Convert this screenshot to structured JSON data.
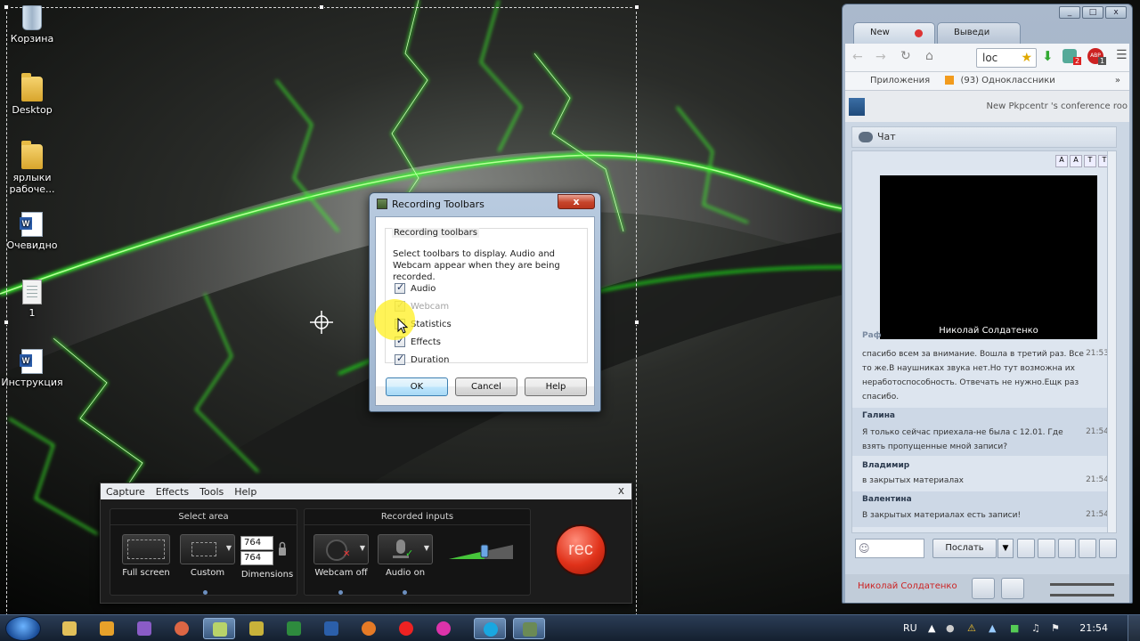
{
  "desktop": {
    "icons": [
      {
        "label": "Корзина",
        "icon": "recycle-bin-icon"
      },
      {
        "label": "Desktop",
        "icon": "folder-icon"
      },
      {
        "label": "ярлыки рабоче...",
        "icon": "folder-icon"
      },
      {
        "label": "Очевидно",
        "icon": "word-document-icon"
      },
      {
        "label": "1",
        "icon": "text-document-icon"
      },
      {
        "label": "Инструкция",
        "icon": "word-document-icon"
      }
    ]
  },
  "dialog": {
    "title": "Recording Toolbars",
    "close_label": "x",
    "group_label": "Recording toolbars",
    "description": "Select toolbars to display. Audio and Webcam appear when they are being recorded.",
    "options": [
      {
        "label": "Audio",
        "checked": true,
        "enabled": true
      },
      {
        "label": "Webcam",
        "checked": true,
        "enabled": false
      },
      {
        "label": "Statistics",
        "checked": false,
        "enabled": true
      },
      {
        "label": "Effects",
        "checked": true,
        "enabled": true
      },
      {
        "label": "Duration",
        "checked": true,
        "enabled": true
      }
    ],
    "ok_label": "OK",
    "cancel_label": "Cancel",
    "help_label": "Help"
  },
  "recorder": {
    "menu": [
      "Capture",
      "Effects",
      "Tools",
      "Help"
    ],
    "close_label": "x",
    "select_area": {
      "title": "Select area",
      "full_screen_label": "Full screen",
      "custom_label": "Custom",
      "dimensions_label": "Dimensions",
      "width": "764",
      "height": "764"
    },
    "recorded_inputs": {
      "title": "Recorded inputs",
      "webcam_label": "Webcam off",
      "audio_label": "Audio on",
      "audio_level": 0.55
    },
    "rec_label": "rec"
  },
  "browser": {
    "window_buttons": [
      "_",
      "□",
      "x"
    ],
    "tabs": [
      "New",
      "Выведи"
    ],
    "url_text": "loc",
    "abp_badge": "ABP",
    "ext_badges": [
      "2",
      "1"
    ],
    "bookmarks": [
      "Приложения",
      "(93) Одноклассники"
    ],
    "conference_title": "New Pkpcentr 's conference roo",
    "chat": {
      "header": "Чат",
      "video_name": "Николай Солдатенко",
      "partial_name": "Раф",
      "messages": [
        {
          "name": "",
          "text": "спасибо всем за внимание. Вошла в третий раз. Все то же.В наушниках звука нет.Но тут возможна их неработоспособность. Отвечать не нужно.Ещк раз спасибо.",
          "time": "21:53"
        },
        {
          "name": "Галина",
          "text": "Я только сейчас приехала-не была с 12.01. Где взять пропущенные мной записи?",
          "time": "21:54"
        },
        {
          "name": "Владимир",
          "text": "в закрытых материалах",
          "time": "21:54"
        },
        {
          "name": "Валентина",
          "text": "В закрытых материалах есть записи!",
          "time": "21:54"
        }
      ],
      "send_label": "Послать",
      "user_name": "Николай Солдатенко"
    }
  },
  "taskbar": {
    "lang": "RU",
    "time": "21:54"
  }
}
